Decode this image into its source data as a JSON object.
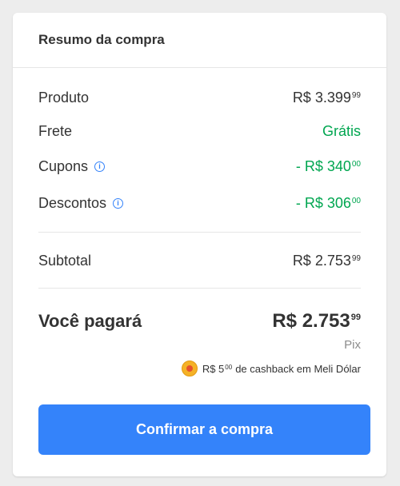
{
  "summary": {
    "title": "Resumo da compra",
    "items": [
      {
        "label": "Produto",
        "value_int": "R$ 3.399",
        "value_cents": "99",
        "has_info": false,
        "green": false
      },
      {
        "label": "Frete",
        "value_text": "Grátis",
        "has_info": false,
        "green": true
      },
      {
        "label": "Cupons",
        "value_int": "- R$ 340",
        "value_cents": "00",
        "has_info": true,
        "green": true
      },
      {
        "label": "Descontos",
        "value_int": "- R$ 306",
        "value_cents": "00",
        "has_info": true,
        "green": true
      }
    ],
    "subtotal": {
      "label": "Subtotal",
      "value_int": "R$ 2.753",
      "value_cents": "99"
    },
    "total": {
      "label": "Você pagará",
      "value_int": "R$ 2.753",
      "value_cents": "99",
      "method": "Pix"
    },
    "cashback": {
      "amount_int": "R$ 5",
      "amount_cents": "00",
      "text": "de cashback em Meli Dólar"
    },
    "confirm_label": "Confirmar a compra"
  },
  "colors": {
    "accent": "#3483fa",
    "green": "#00a650"
  },
  "icons": {
    "info": "info-circle-icon",
    "coin": "meli-dolar-coin-icon"
  }
}
